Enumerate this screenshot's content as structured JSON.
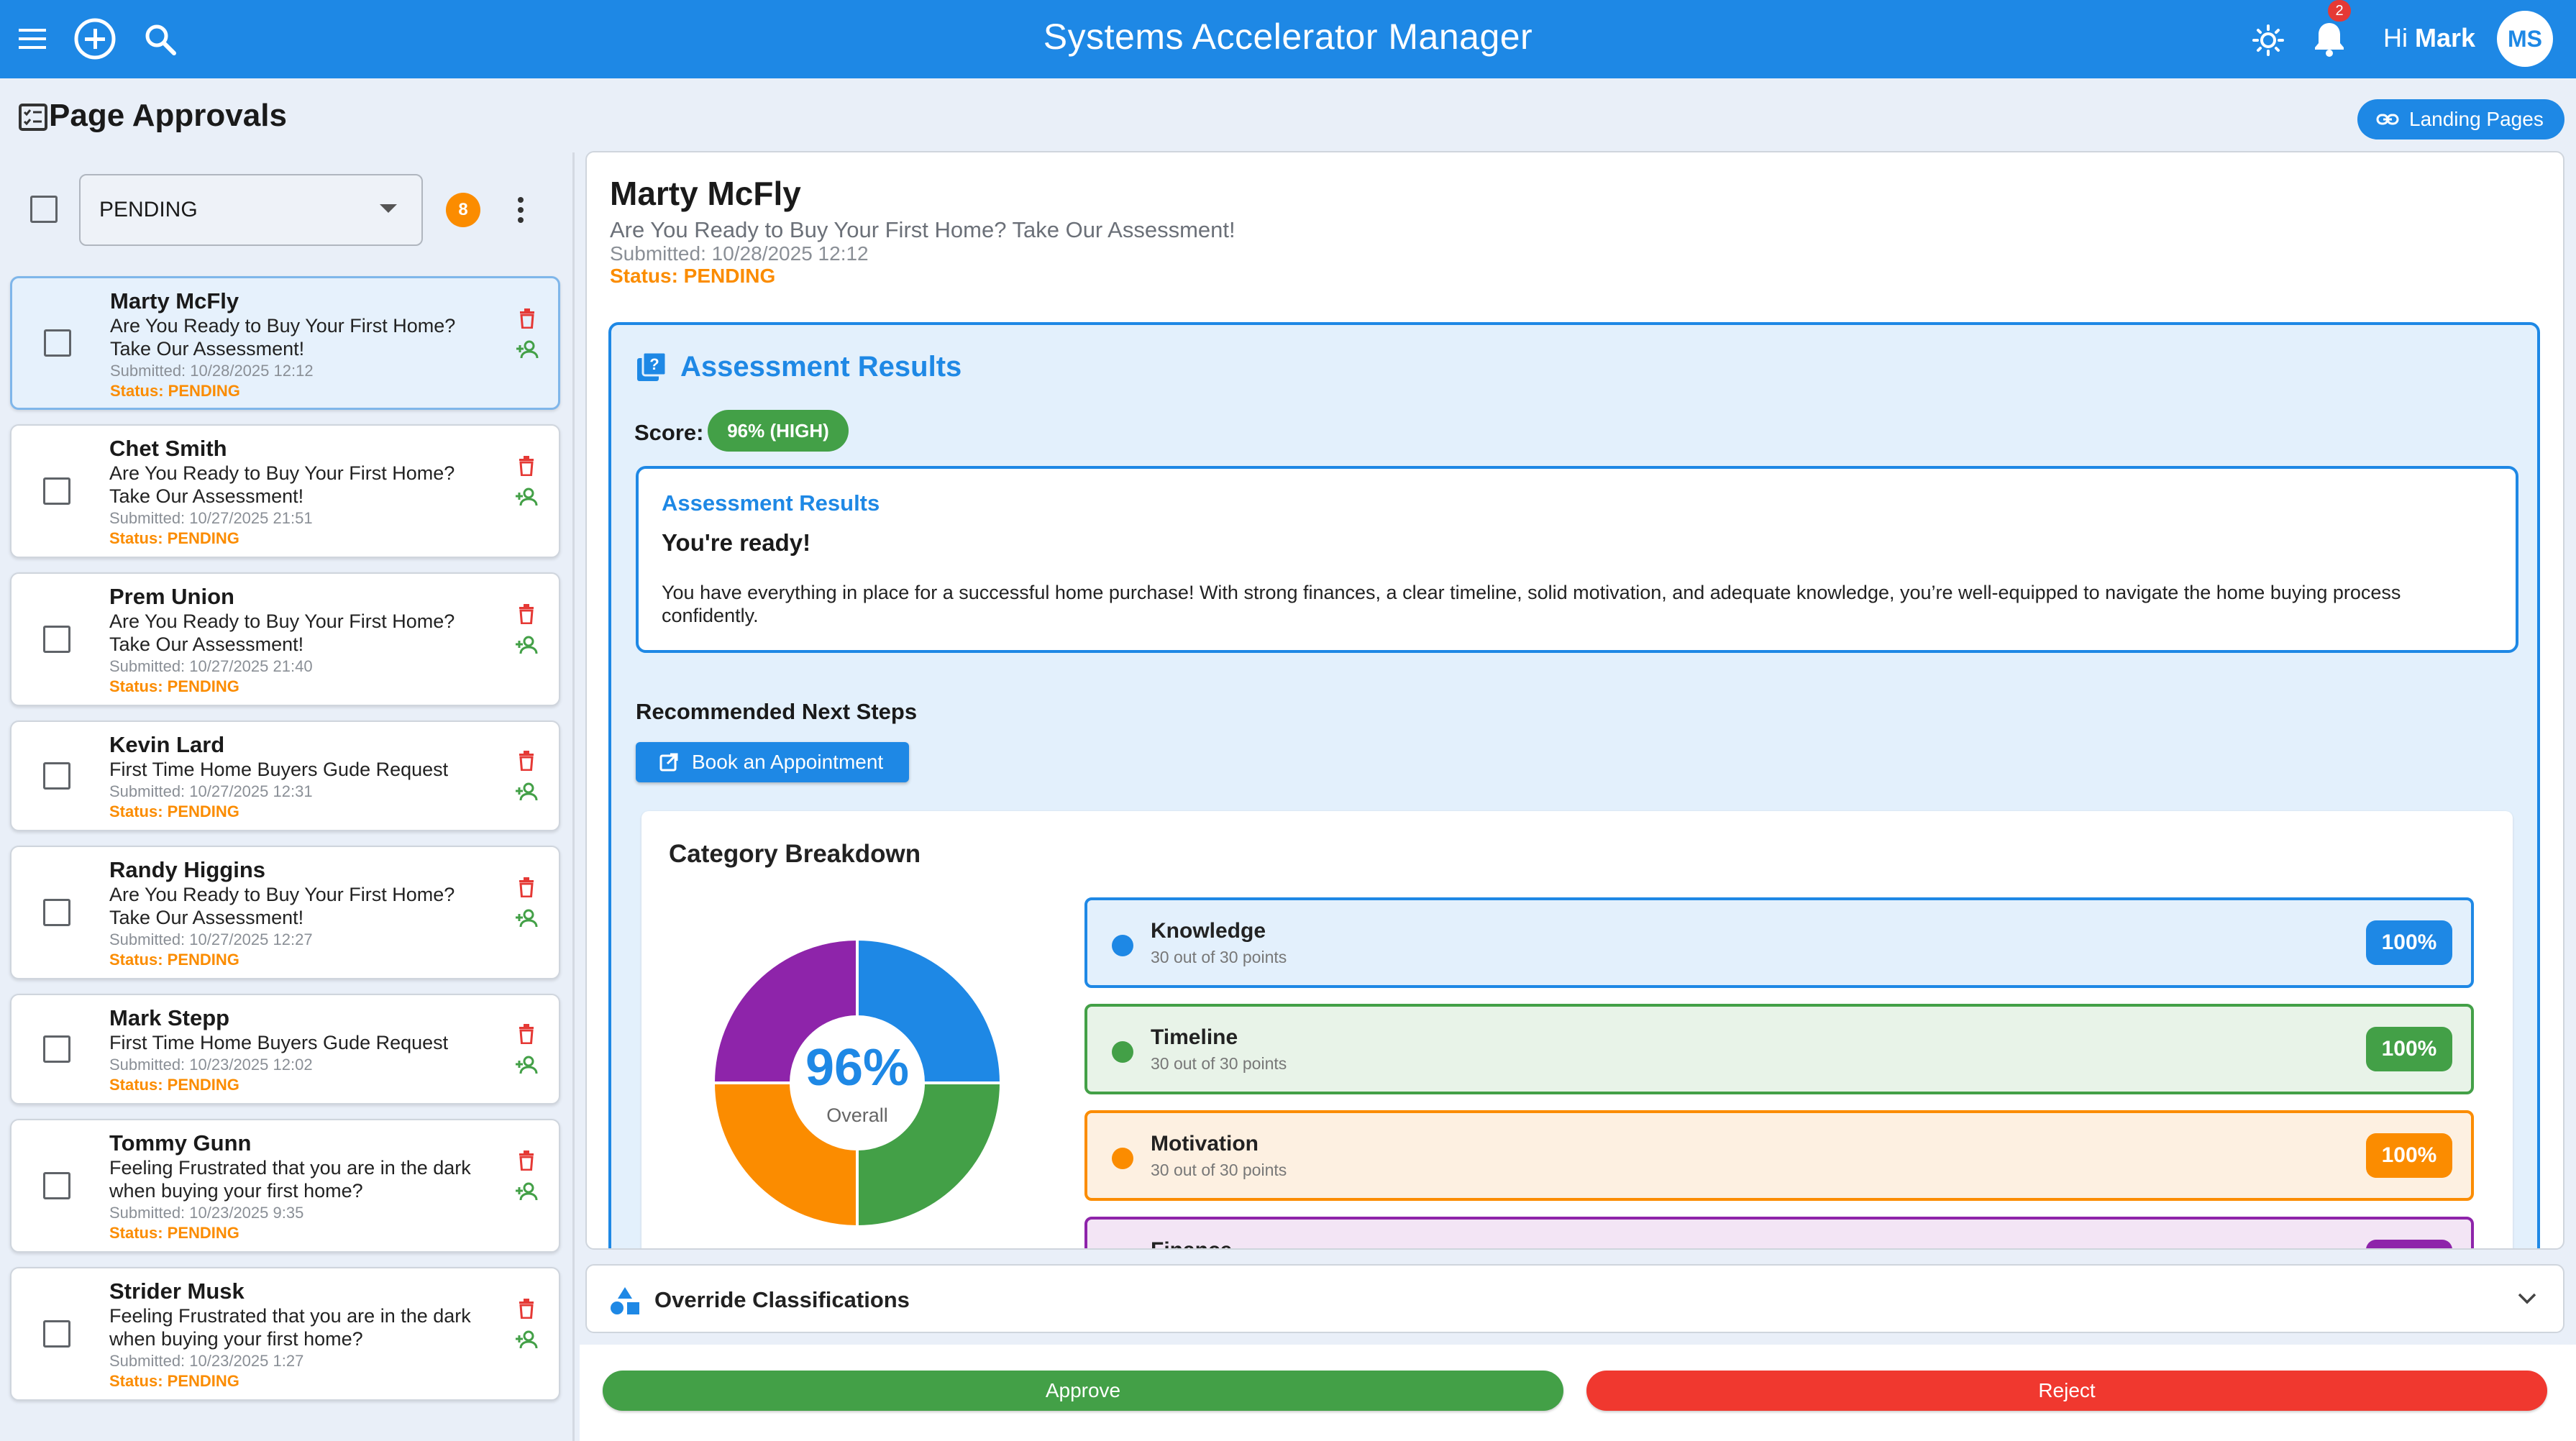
{
  "app": {
    "title": "Systems Accelerator Manager",
    "greeting_prefix": "Hi",
    "user_name": "Mark",
    "avatar_initials": "MS",
    "notification_count": "2",
    "icons": [
      "menu-icon",
      "add-circle-icon",
      "search-icon",
      "theme-toggle-icon",
      "bell-icon"
    ]
  },
  "page": {
    "title": "Page Approvals",
    "landing_pages_label": "Landing Pages"
  },
  "filter": {
    "selected": "PENDING",
    "count": "8"
  },
  "submissions": [
    {
      "name": "Marty McFly",
      "line1": "Are You Ready to Buy Your First Home?",
      "line2": "Take Our Assessment!",
      "submitted": "Submitted: 10/28/2025 12:12",
      "status": "Status: PENDING",
      "selected": true
    },
    {
      "name": "Chet Smith",
      "line1": "Are You Ready to Buy Your First Home?",
      "line2": "Take Our Assessment!",
      "submitted": "Submitted: 10/27/2025 21:51",
      "status": "Status: PENDING"
    },
    {
      "name": "Prem Union",
      "line1": "Are You Ready to Buy Your First Home?",
      "line2": "Take Our Assessment!",
      "submitted": "Submitted: 10/27/2025 21:40",
      "status": "Status: PENDING"
    },
    {
      "name": "Kevin Lard",
      "line1": "First Time Home Buyers Gude Request",
      "line2": "",
      "submitted": "Submitted: 10/27/2025 12:31",
      "status": "Status: PENDING"
    },
    {
      "name": "Randy Higgins",
      "line1": "Are You Ready to Buy Your First Home?",
      "line2": "Take Our Assessment!",
      "submitted": "Submitted: 10/27/2025 12:27",
      "status": "Status: PENDING"
    },
    {
      "name": "Mark Stepp",
      "line1": "First Time Home Buyers Gude Request",
      "line2": "",
      "submitted": "Submitted: 10/23/2025 12:02",
      "status": "Status: PENDING"
    },
    {
      "name": "Tommy Gunn",
      "line1": "Feeling Frustrated that you are in the dark",
      "line2": "when buying your first home?",
      "submitted": "Submitted: 10/23/2025 9:35",
      "status": "Status: PENDING"
    },
    {
      "name": "Strider Musk",
      "line1": "Feeling Frustrated that you are in the dark",
      "line2": "when buying your first home?",
      "submitted": "Submitted: 10/23/2025 1:27",
      "status": "Status: PENDING"
    }
  ],
  "detail": {
    "name": "Marty McFly",
    "subtitle": "Are You Ready to Buy Your First Home? Take Our Assessment!",
    "submitted": "Submitted: 10/28/2025 12:12",
    "status": "Status: PENDING",
    "assessment": {
      "title": "Assessment Results",
      "score_label": "Score:",
      "score_value": "96% (HIGH)",
      "result_box_title": "Assessment Results",
      "result_heading": "You're ready!",
      "result_text": "You have everything in place for a successful home purchase! With strong finances, a clear timeline, solid motivation, and adequate knowledge, you’re well-equipped to navigate the home buying process confidently.",
      "next_steps_label": "Recommended Next Steps",
      "book_button": "Book an Appointment"
    },
    "breakdown": {
      "title": "Category Breakdown",
      "overall_value": "96%",
      "overall_label": "Overall",
      "categories": [
        {
          "name": "Knowledge",
          "score": "30 out of 30 points",
          "percent": "100%",
          "color": "#1e88e5",
          "bg": "#e3f0fc"
        },
        {
          "name": "Timeline",
          "score": "30 out of 30 points",
          "percent": "100%",
          "color": "#43a047",
          "bg": "#e8f3e8"
        },
        {
          "name": "Motivation",
          "score": "30 out of 30 points",
          "percent": "100%",
          "color": "#fb8c00",
          "bg": "#fdf0e1"
        },
        {
          "name": "Finance",
          "score": "",
          "percent": "",
          "color": "#8e24aa",
          "bg": "#f3e5f5"
        }
      ]
    }
  },
  "chart_data": {
    "type": "pie",
    "categories": [
      "Knowledge",
      "Timeline",
      "Motivation",
      "Finance"
    ],
    "values": [
      25,
      25,
      25,
      25
    ],
    "colors": [
      "#1e88e5",
      "#43a047",
      "#fb8c00",
      "#8e24aa"
    ],
    "center_text": "96%",
    "center_label": "Overall"
  },
  "override": {
    "label": "Override Classifications"
  },
  "actions": {
    "approve": "Approve",
    "reject": "Reject"
  }
}
